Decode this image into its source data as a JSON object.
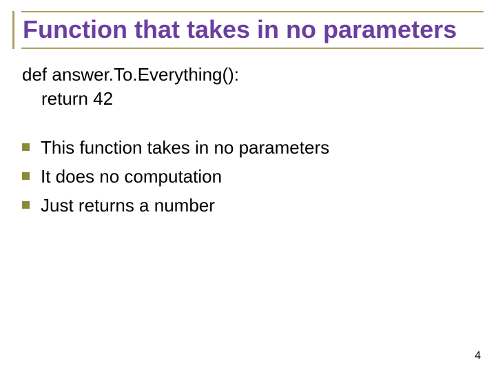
{
  "title": "Function that takes in no parameters",
  "code": {
    "line1": "def answer.To.Everything():",
    "line2": "return 42"
  },
  "bullets": [
    "This function takes in no parameters",
    "It does no computation",
    "Just returns a number"
  ],
  "page_number": "4"
}
